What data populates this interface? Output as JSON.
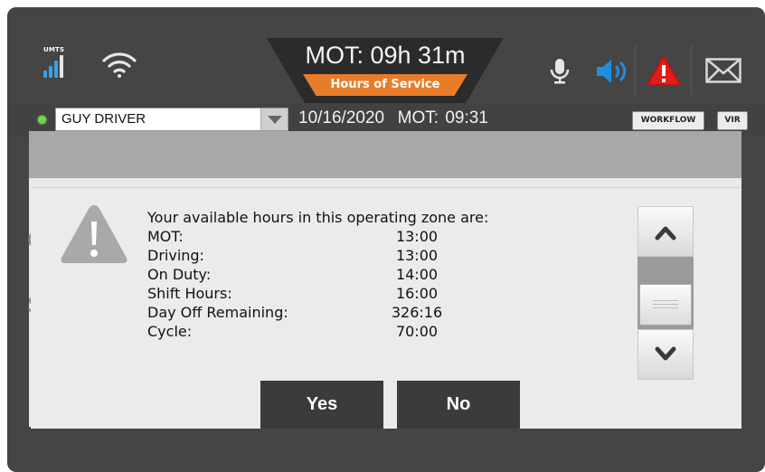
{
  "topbar": {
    "network_label": "UMTS",
    "hos_widget": {
      "title": "MOT: 09h 31m",
      "subtitle": "Hours of Service"
    },
    "icons": [
      "signal-icon",
      "wifi-icon",
      "microphone-icon",
      "speaker-icon",
      "warning-icon",
      "mail-icon"
    ],
    "colors": {
      "accent_orange": "#e77d2b",
      "speaker_blue": "#1e8fe0",
      "alert_red": "#e01c1c"
    }
  },
  "statusbar": {
    "driver_name": "GUY DRIVER",
    "date": "10/16/2020",
    "mot": "MOT: 09:31",
    "workflow_label": "WORKFLOW",
    "vir_label": "VIR"
  },
  "background": {
    "letter1": "C",
    "letter2": "S"
  },
  "dialog": {
    "intro": "Your available hours in this operating zone are:",
    "rows": [
      {
        "label": "MOT:",
        "value": "13:00"
      },
      {
        "label": "Driving:",
        "value": "13:00"
      },
      {
        "label": "On Duty:",
        "value": "14:00"
      },
      {
        "label": "Shift Hours:",
        "value": "16:00"
      },
      {
        "label": "Day Off Remaining:",
        "value": "326:16"
      },
      {
        "label": "Cycle:",
        "value": "70:00"
      }
    ],
    "yes_label": "Yes",
    "no_label": "No"
  }
}
